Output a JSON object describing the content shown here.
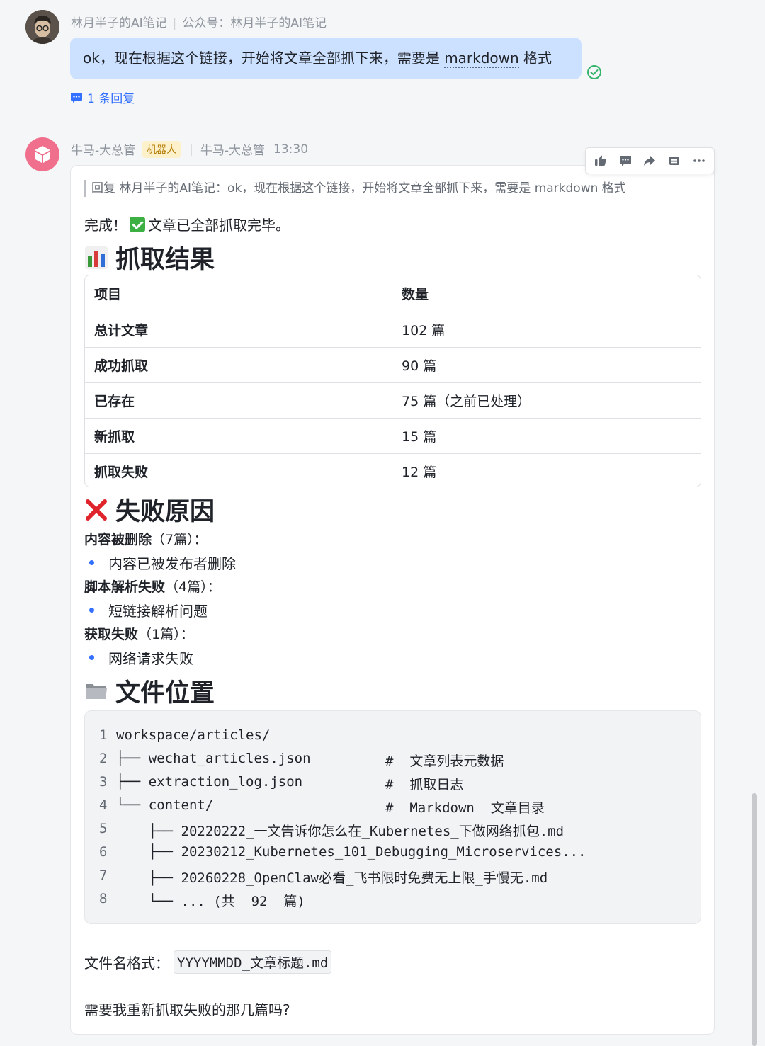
{
  "message1": {
    "sender": "林月半子的AI笔记",
    "channel": "公众号：林月半子的AI笔记",
    "text_before": "ok，现在根据这个链接，开始将文章全部抓下来，需要是 ",
    "text_highlight": "markdown",
    "text_after": " 格式",
    "reply_count": "1 条回复"
  },
  "message2": {
    "sender": "牛马-大总管",
    "badge": "机器人",
    "sender2": "牛马-大总管",
    "time": "13:30",
    "quote": "回复 林月半子的AI笔记：ok，现在根据这个链接，开始将文章全部抓下来，需要是 markdown 格式",
    "done_prefix": "完成！",
    "done_text": "文章已全部抓取完毕。",
    "section1_title": "抓取结果",
    "table": {
      "headers": [
        "项目",
        "数量"
      ],
      "rows": [
        [
          "总计文章",
          "102 篇"
        ],
        [
          "成功抓取",
          "90 篇"
        ],
        [
          "已存在",
          "75 篇（之前已处理）"
        ],
        [
          "新抓取",
          "15 篇"
        ],
        [
          "抓取失败",
          "12 篇"
        ]
      ]
    },
    "section2_title": "失败原因",
    "reasons": [
      {
        "title": "内容被删除",
        "count": "（7篇）：",
        "item": "内容已被发布者删除"
      },
      {
        "title": "脚本解析失败",
        "count": "（4篇）：",
        "item": "短链接解析问题"
      },
      {
        "title": "获取失败",
        "count": "（1篇）：",
        "item": "网络请求失败"
      }
    ],
    "section3_title": "文件位置",
    "code_lines": [
      {
        "n": "1",
        "text": "workspace/articles/",
        "comment": ""
      },
      {
        "n": "2",
        "text": "├── wechat_articles.json",
        "comment": "#  文章列表元数据"
      },
      {
        "n": "3",
        "text": "├── extraction_log.json",
        "comment": "#  抓取日志"
      },
      {
        "n": "4",
        "text": "└── content/",
        "comment": "#  Markdown  文章目录"
      },
      {
        "n": "5",
        "text": "    ├── 20220222_一文告诉你怎么在_Kubernetes_下做网络抓包.md",
        "comment": ""
      },
      {
        "n": "6",
        "text": "    ├── 20230212_Kubernetes_101_Debugging_Microservices...",
        "comment": ""
      },
      {
        "n": "7",
        "text": "    ├── 20260228_OpenClaw必看_飞书限时免费无上限_手慢无.md",
        "comment": ""
      },
      {
        "n": "8",
        "text": "    └── ... (共  92  篇)",
        "comment": ""
      }
    ],
    "filename_label": "文件名格式：",
    "filename_format": "YYYYMMDD_文章标题.md",
    "ask": "需要我重新抓取失败的那几篇吗?"
  },
  "toolbar_icons": [
    "thumbs-up-icon",
    "comment-icon",
    "forward-icon",
    "archive-icon",
    "more-icon"
  ],
  "colors": {
    "bubble": "#cce0ff",
    "accent": "#3370ff",
    "check": "#34b36b",
    "bot_avatar": "#ef6f8c",
    "badge_bg": "#fdf1cc"
  }
}
